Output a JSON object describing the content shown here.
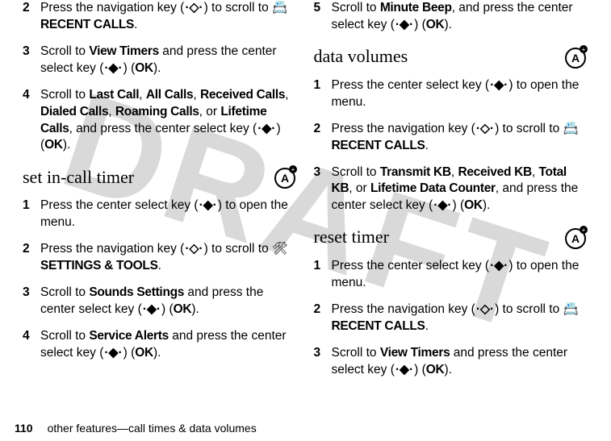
{
  "left": {
    "steps_a": [
      {
        "n": "2",
        "pre": "Press the navigation key (",
        "g": "·◇·",
        "mid": ") to scroll to ",
        "icon": "📇",
        "b": "RECENT CALLS",
        "post": "."
      },
      {
        "n": "3",
        "pre": "Scroll to ",
        "b": "View Timers",
        "mid": " and press the center select key (",
        "g": "·◆·",
        "mid2": ") (",
        "b2": "OK",
        "post": ")."
      },
      {
        "n": "4",
        "pre": "Scroll to ",
        "list": [
          "Last Call",
          "All Calls",
          "Received Calls",
          "Dialed Calls",
          "Roaming Calls",
          "Lifetime Calls"
        ],
        "mid": ", and press the center select key (",
        "g": "·◆·",
        "mid2": ") (",
        "b2": "OK",
        "post": ")."
      }
    ],
    "heading": "set in-call timer",
    "steps_b": [
      {
        "n": "1",
        "pre": "Press the center select key (",
        "g": "·◆·",
        "post": ") to open the menu."
      },
      {
        "n": "2",
        "pre": "Press the navigation key (",
        "g": "·◇·",
        "mid": ") to scroll to ",
        "icon": "🛠",
        "b": "SETTINGS & TOOLS",
        "post": "."
      },
      {
        "n": "3",
        "pre": "Scroll to ",
        "b": "Sounds Settings",
        "mid": " and press the center select key (",
        "g": "·◆·",
        "mid2": ") (",
        "b2": "OK",
        "post": ")."
      },
      {
        "n": "4",
        "pre": "Scroll to ",
        "b": "Service Alerts",
        "mid": " and press the center select key (",
        "g": "·◆·",
        "mid2": ") (",
        "b2": "OK",
        "post": ")."
      }
    ]
  },
  "right": {
    "steps_a": [
      {
        "n": "5",
        "pre": "Scroll to ",
        "b": "Minute Beep",
        "mid": ", and press the center select key (",
        "g": "·◆·",
        "mid2": ") (",
        "b2": "OK",
        "post": ")."
      }
    ],
    "heading1": "data volumes",
    "steps_b": [
      {
        "n": "1",
        "pre": "Press the center select key (",
        "g": "·◆·",
        "post": ") to open the menu."
      },
      {
        "n": "2",
        "pre": "Press the navigation key (",
        "g": "·◇·",
        "mid": ") to scroll to ",
        "icon": "📇",
        "b": "RECENT CALLS",
        "post": "."
      },
      {
        "n": "3",
        "pre": "Scroll to ",
        "list": [
          "Transmit KB",
          "Received KB",
          "Total KB",
          "Lifetime Data Counter"
        ],
        "mid": ", and press the center select key (",
        "g": "·◆·",
        "mid2": ") (",
        "b2": "OK",
        "post": ")."
      }
    ],
    "heading2": "reset timer",
    "steps_c": [
      {
        "n": "1",
        "pre": "Press the center select key (",
        "g": "·◆·",
        "post": ") to open the menu."
      },
      {
        "n": "2",
        "pre": "Press the navigation key (",
        "g": "·◇·",
        "mid": ") to scroll to ",
        "icon": "📇",
        "b": "RECENT CALLS",
        "post": "."
      },
      {
        "n": "3",
        "pre": "Scroll to ",
        "b": "View Timers",
        "mid": " and press the center select key (",
        "g": "·◆·",
        "mid2": ") (",
        "b2": "OK",
        "post": ")."
      }
    ]
  },
  "footer": {
    "page": "110",
    "text": "other features—call times & data volumes"
  },
  "watermark": "DRAFT"
}
